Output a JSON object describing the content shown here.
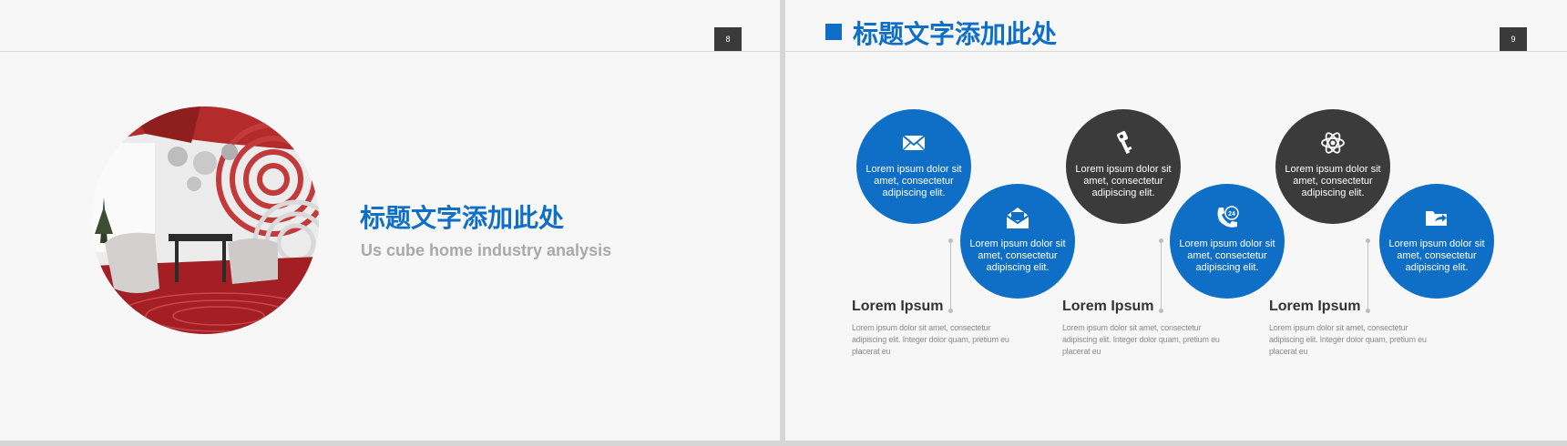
{
  "slide8": {
    "page_number": "8",
    "title": "标题文字添加此处",
    "subtitle": "Us cube home industry analysis"
  },
  "slide9": {
    "page_number": "9",
    "title": "标题文字添加此处",
    "circles": [
      {
        "icon": "envelope-icon",
        "text": "Lorem ipsum dolor sit amet, consectetur adipiscing elit.",
        "color": "#0f6fc6"
      },
      {
        "icon": "open-mail-icon",
        "text": "Lorem ipsum dolor sit amet, consectetur adipiscing elit.",
        "color": "#0f6fc6"
      },
      {
        "icon": "key-icon",
        "text": "Lorem ipsum dolor sit amet, consectetur adipiscing elit.",
        "color": "#3b3b3b"
      },
      {
        "icon": "phone-24-icon",
        "text": "Lorem ipsum dolor sit amet, consectetur adipiscing elit.",
        "color": "#0f6fc6"
      },
      {
        "icon": "atom-icon",
        "text": "Lorem ipsum dolor sit amet, consectetur adipiscing elit.",
        "color": "#3b3b3b"
      },
      {
        "icon": "folder-share-icon",
        "text": "Lorem ipsum dolor sit amet, consectetur adipiscing elit.",
        "color": "#0f6fc6"
      }
    ],
    "items": [
      {
        "heading": "Lorem Ipsum",
        "body": "Lorem ipsum dolor sit amet, consectetur adipiscing elit. Integer dolor quam, pretium eu placerat eu"
      },
      {
        "heading": "Lorem Ipsum",
        "body": "Lorem ipsum dolor sit amet, consectetur adipiscing elit. Integer dolor quam, pretium eu placerat eu"
      },
      {
        "heading": "Lorem Ipsum",
        "body": "Lorem ipsum dolor sit amet, consectetur adipiscing elit. Integer dolor quam, pretium eu placerat eu"
      }
    ]
  },
  "colors": {
    "accent_blue": "#0f6fc6",
    "dark_gray": "#3b3b3b",
    "background": "#f7f7f7"
  }
}
